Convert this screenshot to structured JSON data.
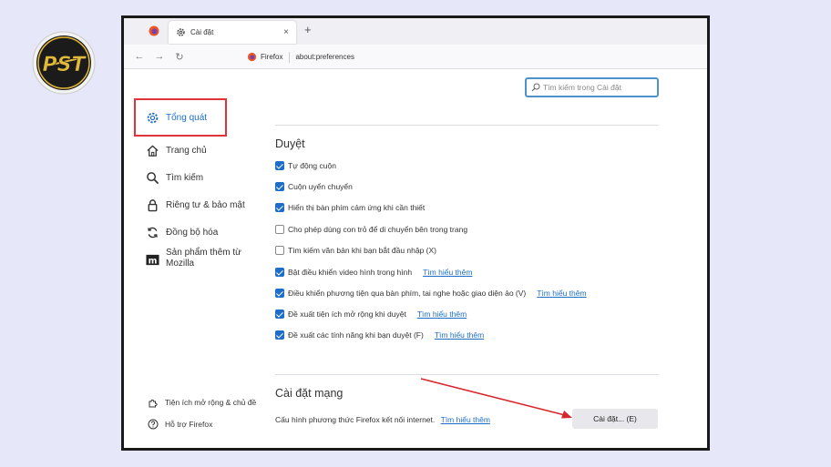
{
  "browser": {
    "tab_title": "Cài đặt",
    "tab_close": "×",
    "new_tab": "+",
    "back": "←",
    "forward": "→",
    "reload": "↻",
    "identity_label": "Firefox",
    "url": "about:preferences"
  },
  "search": {
    "placeholder": "Tìm kiếm trong Cài đặt"
  },
  "sidebar": {
    "items": [
      {
        "label": "Tổng quát",
        "icon": "gear-icon"
      },
      {
        "label": "Trang chủ",
        "icon": "home-icon"
      },
      {
        "label": "Tìm kiếm",
        "icon": "search-icon"
      },
      {
        "label": "Riêng tư & bảo mật",
        "icon": "lock-icon"
      },
      {
        "label": "Đồng bộ hóa",
        "icon": "sync-icon"
      },
      {
        "label_line1": "Sản phẩm thêm từ",
        "label_line2": "Mozilla",
        "icon": "mozilla-icon"
      }
    ],
    "footer": [
      {
        "label": "Tiện ích mở rộng & chủ đề",
        "icon": "puzzle-icon"
      },
      {
        "label": "Hỗ trợ Firefox",
        "icon": "help-icon"
      }
    ]
  },
  "browsing": {
    "title": "Duyệt",
    "options": [
      {
        "label": "Tự động cuộn",
        "checked": true
      },
      {
        "label": "Cuộn uyển chuyển",
        "checked": true
      },
      {
        "label": "Hiển thị bàn phím cảm ứng khi cần thiết",
        "checked": true
      },
      {
        "label": "Cho phép dùng con trỏ để di chuyển bên trong trang",
        "checked": false
      },
      {
        "label": "Tìm kiếm văn bản khi bạn bắt đầu nhập (X)",
        "checked": false
      },
      {
        "label": "Bật điều khiển video hình trong hình",
        "checked": true,
        "link": "Tìm hiểu thêm"
      },
      {
        "label": "Điều khiển phương tiện qua bàn phím, tai nghe hoặc giao diện ảo (V)",
        "checked": true,
        "link": "Tìm hiểu thêm"
      },
      {
        "label": "Đề xuất tiện ích mở rộng khi duyệt",
        "checked": true,
        "link": "Tìm hiểu thêm"
      },
      {
        "label": "Đề xuất các tính năng khi bạn duyệt (F)",
        "checked": true,
        "link": "Tìm hiểu thêm"
      }
    ]
  },
  "network": {
    "title": "Cài đặt mạng",
    "description": "Cấu hình phương thức Firefox kết nối internet.",
    "link": "Tìm hiểu thêm",
    "button": "Cài đặt... (E)"
  },
  "logo": {
    "text": "PST"
  },
  "colors": {
    "accent": "#1d6dc9",
    "highlight": "#e0343a",
    "background": "#e6e8f9"
  }
}
